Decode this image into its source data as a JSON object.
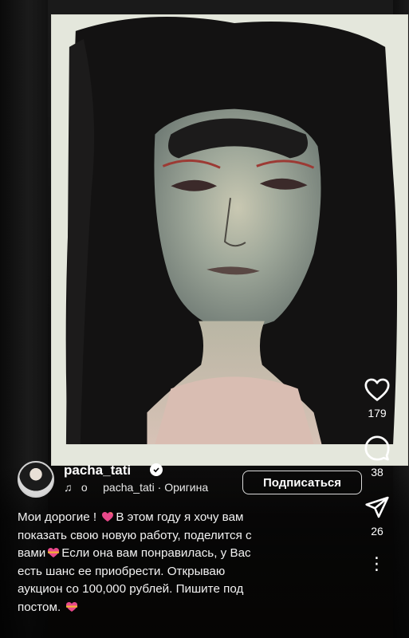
{
  "author": {
    "username": "pacha_tati",
    "audio_prefix": "о",
    "audio_user": "pacha_tati",
    "audio_label": "· Оригина",
    "follow_label": "Подписаться"
  },
  "actions": {
    "likes": "179",
    "comments": "38",
    "shares": "26"
  },
  "caption": {
    "line1a": "Мои дорогие ! ",
    "line1b": "В этом году я хочу вам",
    "line2": "показать свою новую работу, поделится с",
    "line3a": "вами",
    "line3b": "Если она вам понравилась, у Вас",
    "line4": "есть шанс ее приобрести. Открываю",
    "line5": "аукцион со 100,000 рублей. Пишите под",
    "line6": "постом. "
  },
  "colors": {
    "accent_pink": "#e7488a",
    "gold": "#f2b233"
  },
  "icons": [
    "heart-outline-icon",
    "comment-bubble-icon",
    "send-paper-plane-icon",
    "more-dots-icon",
    "music-note-icon",
    "verified-badge-icon"
  ]
}
